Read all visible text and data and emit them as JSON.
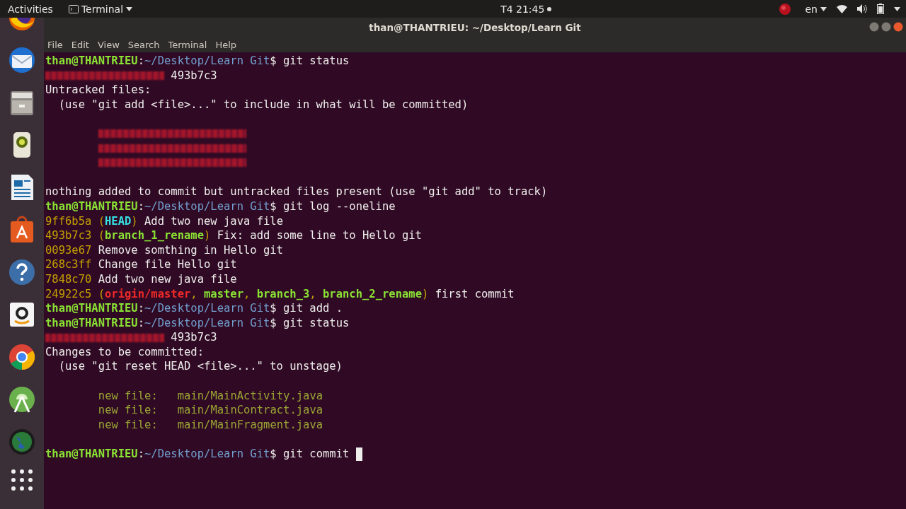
{
  "top_bar": {
    "activities": "Activities",
    "app_menu": "Terminal",
    "clock": "T4 21:45",
    "language": "en"
  },
  "window": {
    "title": "than@THANTRIEU: ~/Desktop/Learn Git"
  },
  "menu": [
    "File",
    "Edit",
    "View",
    "Search",
    "Terminal",
    "Help"
  ],
  "terminal": {
    "lines": [
      {
        "kind": "text",
        "segments": [
          {
            "kind": "user",
            "text": "than@THANTRIEU"
          },
          {
            "kind": "plain",
            "text": ":"
          },
          {
            "kind": "path",
            "text": "~/Desktop/Learn Git"
          },
          {
            "kind": "plain",
            "text": "$ git status"
          }
        ]
      },
      {
        "kind": "text",
        "segments": [
          {
            "kind": "redacted_short"
          },
          {
            "kind": "plain",
            "text": " 493b7c3"
          }
        ]
      },
      {
        "kind": "text",
        "segments": [
          {
            "kind": "plain",
            "text": "Untracked files:"
          }
        ]
      },
      {
        "kind": "text",
        "segments": [
          {
            "kind": "plain",
            "text": "  (use \"git add <file>...\" to include in what will be committed)"
          }
        ]
      },
      {
        "kind": "blank"
      },
      {
        "kind": "text",
        "segments": [
          {
            "kind": "indent"
          },
          {
            "kind": "redacted_long"
          }
        ]
      },
      {
        "kind": "text",
        "segments": [
          {
            "kind": "indent"
          },
          {
            "kind": "redacted_long"
          }
        ]
      },
      {
        "kind": "text",
        "segments": [
          {
            "kind": "indent"
          },
          {
            "kind": "redacted_long"
          }
        ]
      },
      {
        "kind": "blank"
      },
      {
        "kind": "text",
        "segments": [
          {
            "kind": "plain",
            "text": "nothing added to commit but untracked files present (use \"git add\" to track)"
          }
        ]
      },
      {
        "kind": "text",
        "segments": [
          {
            "kind": "user",
            "text": "than@THANTRIEU"
          },
          {
            "kind": "plain",
            "text": ":"
          },
          {
            "kind": "path",
            "text": "~/Desktop/Learn Git"
          },
          {
            "kind": "plain",
            "text": "$ git log --oneline"
          }
        ]
      },
      {
        "kind": "text",
        "segments": [
          {
            "kind": "hash",
            "text": "9ff6b5a ("
          },
          {
            "kind": "head",
            "text": "HEAD"
          },
          {
            "kind": "hash",
            "text": ")"
          },
          {
            "kind": "plain",
            "text": " Add two new java file"
          }
        ]
      },
      {
        "kind": "text",
        "segments": [
          {
            "kind": "hash",
            "text": "493b7c3 ("
          },
          {
            "kind": "branch",
            "text": "branch_1_rename"
          },
          {
            "kind": "hash",
            "text": ")"
          },
          {
            "kind": "plain",
            "text": " Fix: add some line to Hello git"
          }
        ]
      },
      {
        "kind": "text",
        "segments": [
          {
            "kind": "hash",
            "text": "0093e67"
          },
          {
            "kind": "plain",
            "text": " Remove somthing in Hello git"
          }
        ]
      },
      {
        "kind": "text",
        "segments": [
          {
            "kind": "hash",
            "text": "268c3ff"
          },
          {
            "kind": "plain",
            "text": " Change file Hello git"
          }
        ]
      },
      {
        "kind": "text",
        "segments": [
          {
            "kind": "hash",
            "text": "7848c70"
          },
          {
            "kind": "plain",
            "text": " Add two new java file"
          }
        ]
      },
      {
        "kind": "text",
        "segments": [
          {
            "kind": "hash",
            "text": "24922c5 ("
          },
          {
            "kind": "remote",
            "text": "origin/master"
          },
          {
            "kind": "hash",
            "text": ", "
          },
          {
            "kind": "branch",
            "text": "master"
          },
          {
            "kind": "hash",
            "text": ", "
          },
          {
            "kind": "branch",
            "text": "branch_3"
          },
          {
            "kind": "hash",
            "text": ", "
          },
          {
            "kind": "branch",
            "text": "branch_2_rename"
          },
          {
            "kind": "hash",
            "text": ")"
          },
          {
            "kind": "plain",
            "text": " first commit"
          }
        ]
      },
      {
        "kind": "text",
        "segments": [
          {
            "kind": "user",
            "text": "than@THANTRIEU"
          },
          {
            "kind": "plain",
            "text": ":"
          },
          {
            "kind": "path",
            "text": "~/Desktop/Learn Git"
          },
          {
            "kind": "plain",
            "text": "$ git add ."
          }
        ]
      },
      {
        "kind": "text",
        "segments": [
          {
            "kind": "user",
            "text": "than@THANTRIEU"
          },
          {
            "kind": "plain",
            "text": ":"
          },
          {
            "kind": "path",
            "text": "~/Desktop/Learn Git"
          },
          {
            "kind": "plain",
            "text": "$ git status"
          }
        ]
      },
      {
        "kind": "text",
        "segments": [
          {
            "kind": "redacted_short"
          },
          {
            "kind": "plain",
            "text": " 493b7c3"
          }
        ]
      },
      {
        "kind": "text",
        "segments": [
          {
            "kind": "plain",
            "text": "Changes to be committed:"
          }
        ]
      },
      {
        "kind": "text",
        "segments": [
          {
            "kind": "plain",
            "text": "  (use \"git reset HEAD <file>...\" to unstage)"
          }
        ]
      },
      {
        "kind": "blank"
      },
      {
        "kind": "text",
        "segments": [
          {
            "kind": "indent"
          },
          {
            "kind": "staged",
            "text": "new file:   main/MainActivity.java"
          }
        ]
      },
      {
        "kind": "text",
        "segments": [
          {
            "kind": "indent"
          },
          {
            "kind": "staged",
            "text": "new file:   main/MainContract.java"
          }
        ]
      },
      {
        "kind": "text",
        "segments": [
          {
            "kind": "indent"
          },
          {
            "kind": "staged",
            "text": "new file:   main/MainFragment.java"
          }
        ]
      },
      {
        "kind": "blank"
      },
      {
        "kind": "text",
        "segments": [
          {
            "kind": "user",
            "text": "than@THANTRIEU"
          },
          {
            "kind": "plain",
            "text": ":"
          },
          {
            "kind": "path",
            "text": "~/Desktop/Learn Git"
          },
          {
            "kind": "plain",
            "text": "$ git commit "
          },
          {
            "kind": "cursor"
          }
        ]
      }
    ]
  }
}
